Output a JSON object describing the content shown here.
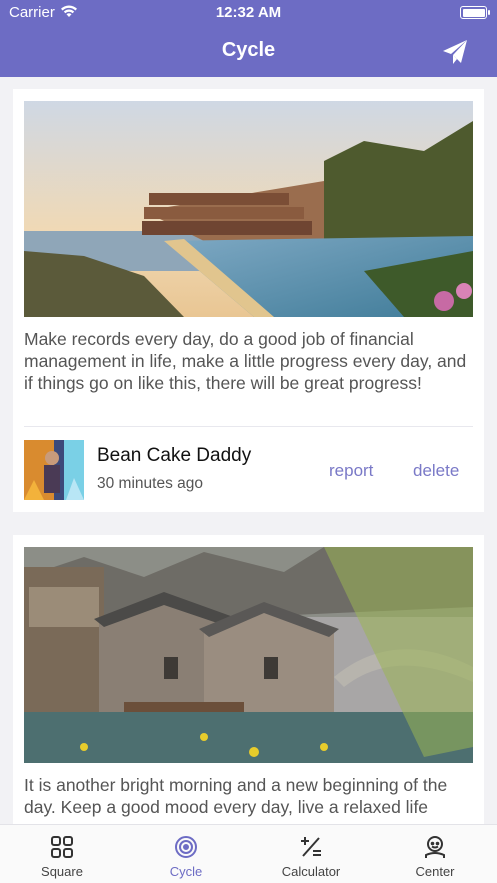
{
  "status_bar": {
    "carrier": "Carrier",
    "time": "12:32 AM",
    "icons": [
      "wifi-icon",
      "battery-icon"
    ]
  },
  "nav": {
    "title": "Cycle",
    "action_icon": "send-paper-plane-icon"
  },
  "posts": [
    {
      "image": "resort-infinity-pool-photo",
      "text": "Make records every day, do a good job of financial management in life, make a little progress every day, and if things go on like this, there will be great progress!",
      "author": "Bean Cake Daddy",
      "time_ago": "30 minutes ago",
      "report_label": "report",
      "delete_label": "delete"
    },
    {
      "image": "water-town-stone-houses-photo",
      "text": "It is another bright morning and a new beginning of the day. Keep a good mood every day, live a relaxed life"
    }
  ],
  "tabs": [
    {
      "label": "Square",
      "icon": "grid-icon",
      "active": false
    },
    {
      "label": "Cycle",
      "icon": "target-icon",
      "active": true
    },
    {
      "label": "Calculator",
      "icon": "calculator-icon",
      "active": false
    },
    {
      "label": "Center",
      "icon": "user-icon",
      "active": false
    }
  ],
  "colors": {
    "primary": "#6d6cc4",
    "link": "#7a79c7",
    "background": "#f2f2f5"
  }
}
